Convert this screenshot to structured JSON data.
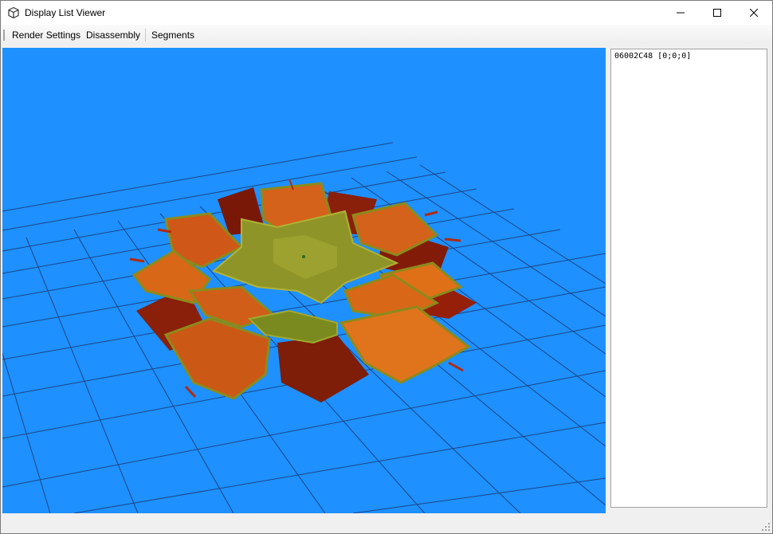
{
  "window": {
    "title": "Display List Viewer",
    "icon": "cube-icon",
    "controls": {
      "minimize": "minimize-icon",
      "maximize": "maximize-icon",
      "close": "close-icon"
    }
  },
  "menu": {
    "items": [
      {
        "label": "Render Settings"
      },
      {
        "label": "Disassembly"
      },
      {
        "label": "Segments"
      }
    ]
  },
  "viewport": {
    "background_color": "#1e90ff",
    "grid_color": "#1a3a6e",
    "model": "flower-model"
  },
  "display_list": {
    "items": [
      {
        "label": "06002C48 [0;0;0]"
      }
    ]
  }
}
